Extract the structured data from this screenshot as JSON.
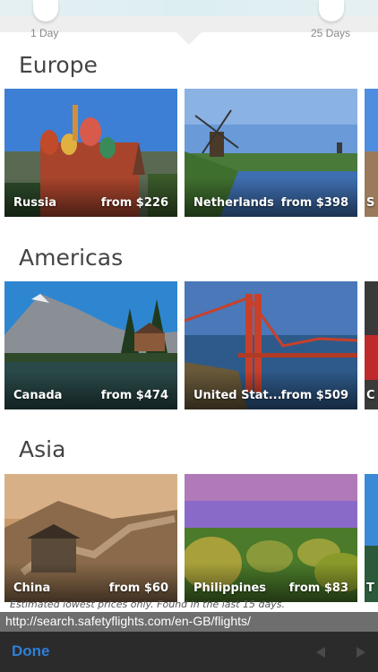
{
  "slider": {
    "min_label": "1 Day",
    "max_label": "25 Days"
  },
  "sections": [
    {
      "title": "Europe",
      "cards": [
        {
          "name": "Russia",
          "price": "from $226"
        },
        {
          "name": "Netherlands",
          "price": "from $398"
        },
        {
          "name": "S",
          "price": ""
        }
      ]
    },
    {
      "title": "Americas",
      "cards": [
        {
          "name": "Canada",
          "price": "from $474"
        },
        {
          "name": "United Stat...",
          "price": "from $509"
        },
        {
          "name": "C",
          "price": ""
        }
      ]
    },
    {
      "title": "Asia",
      "cards": [
        {
          "name": "China",
          "price": "from $60"
        },
        {
          "name": "Philippines",
          "price": "from $83"
        },
        {
          "name": "T",
          "price": ""
        }
      ]
    }
  ],
  "disclaimer": "Estimated lowest prices only. Found in the last 15 days.",
  "url": "http://search.safetyflights.com/en-GB/flights/",
  "toolbar": {
    "done_label": "Done"
  },
  "colors": {
    "accent": "#2f7fd8",
    "toolbar_bg": "#2b2b2b",
    "url_bar_bg": "#6e6e6e"
  }
}
